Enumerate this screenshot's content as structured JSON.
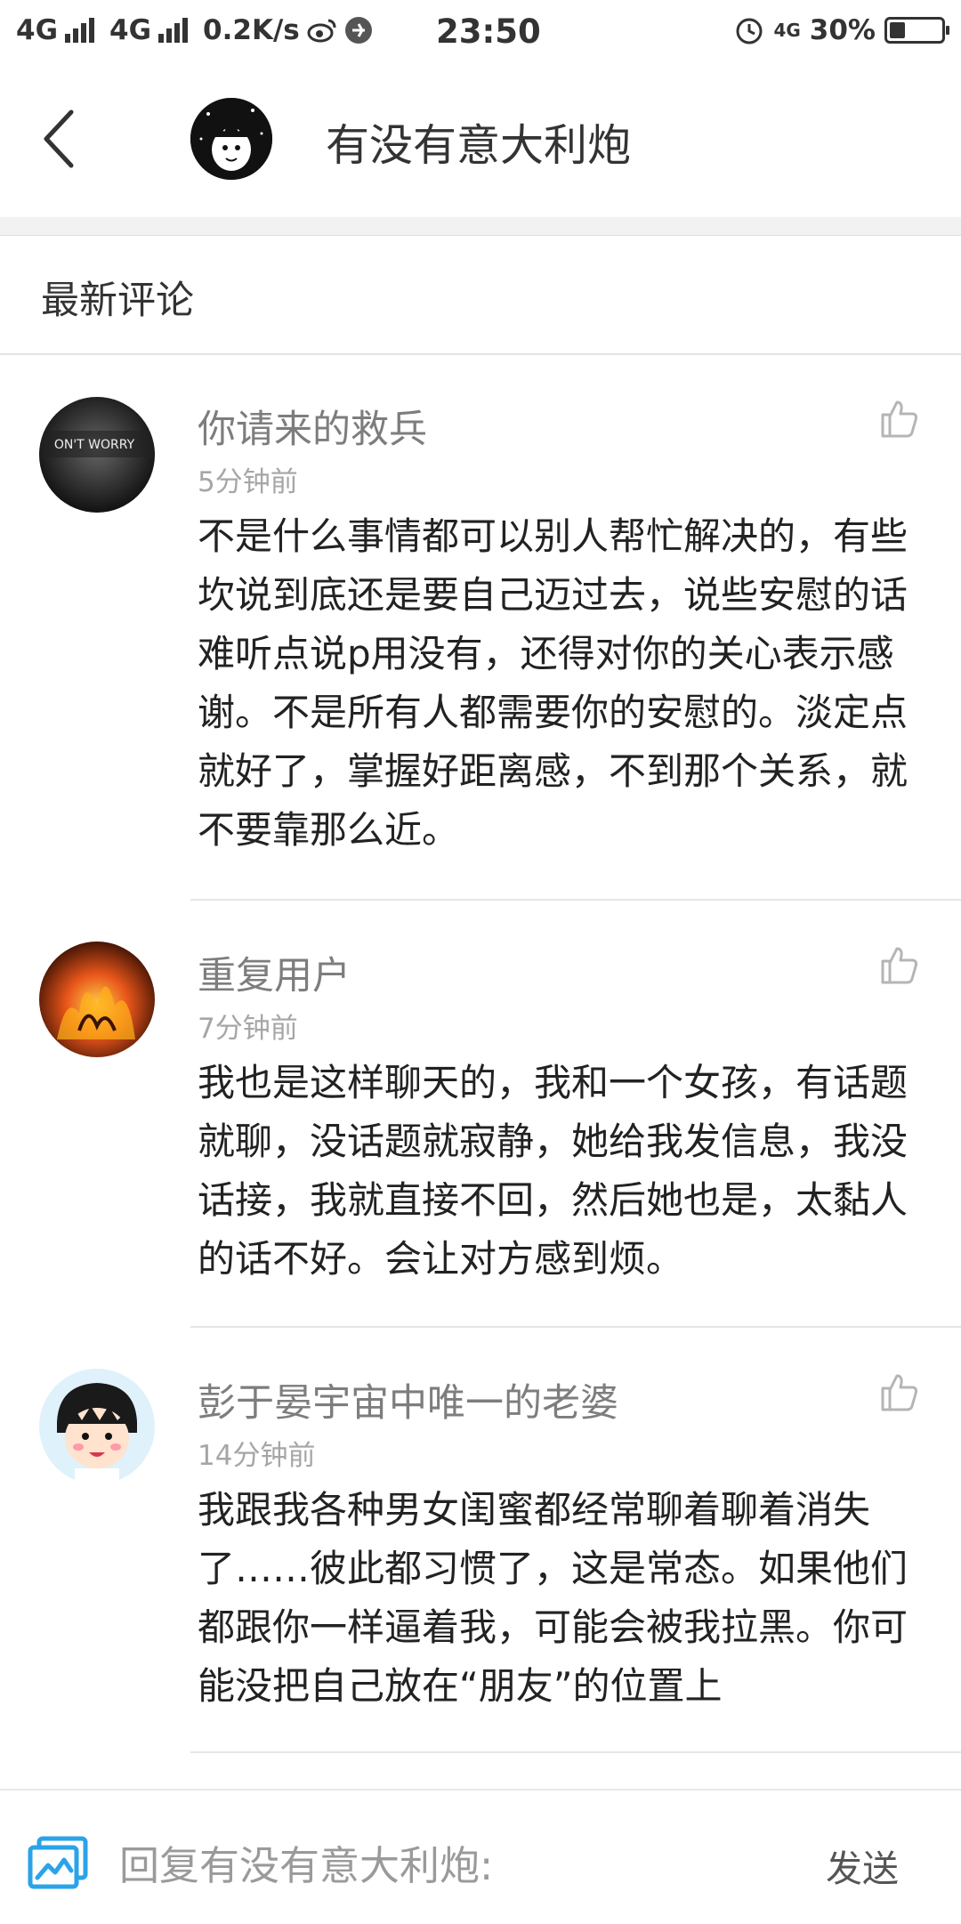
{
  "status_bar": {
    "network1": "4G",
    "network2": "4G",
    "speed": "0.2K/s",
    "time": "23:50",
    "network3": "4G",
    "battery_percent_text": "30%",
    "battery_level": 0.3
  },
  "header": {
    "title": "有没有意大利炮"
  },
  "section": {
    "title": "最新评论"
  },
  "comments": [
    {
      "name": "你请来的救兵",
      "time": "5分钟前",
      "avatar_text": "ON'T WORRY",
      "text": "不是什么事情都可以别人帮忙解决的，有些坎说到底还是要自己迈过去，说些安慰的话难听点说p用没有，还得对你的关心表示感谢。不是所有人都需要你的安慰的。淡定点就好了，掌握好距离感，不到那个关系，就不要靠那么近。"
    },
    {
      "name": "重复用户",
      "time": "7分钟前",
      "text": "我也是这样聊天的，我和一个女孩，有话题就聊，没话题就寂静，她给我发信息，我没话接，我就直接不回，然后她也是，太黏人的话不好。会让对方感到烦。"
    },
    {
      "name": "彭于晏宇宙中唯一的老婆",
      "time": "14分钟前",
      "text": "我跟我各种男女闺蜜都经常聊着聊着消失了……彼此都习惯了，这是常态。如果他们都跟你一样逼着我，可能会被我拉黑。你可能没把自己放在“朋友”的位置上"
    }
  ],
  "reply_bar": {
    "placeholder": "回复有没有意大利炮:",
    "send_label": "发送"
  },
  "icons": {
    "back": "chevron-left-icon",
    "like": "thumbs-up-icon",
    "reply": "image-icon",
    "alarm": "alarm-icon",
    "weibo": "weibo-icon"
  },
  "colors": {
    "reply_icon": "#2aa3e8",
    "name": "#7d7d7d",
    "time": "#a6a6a6"
  }
}
